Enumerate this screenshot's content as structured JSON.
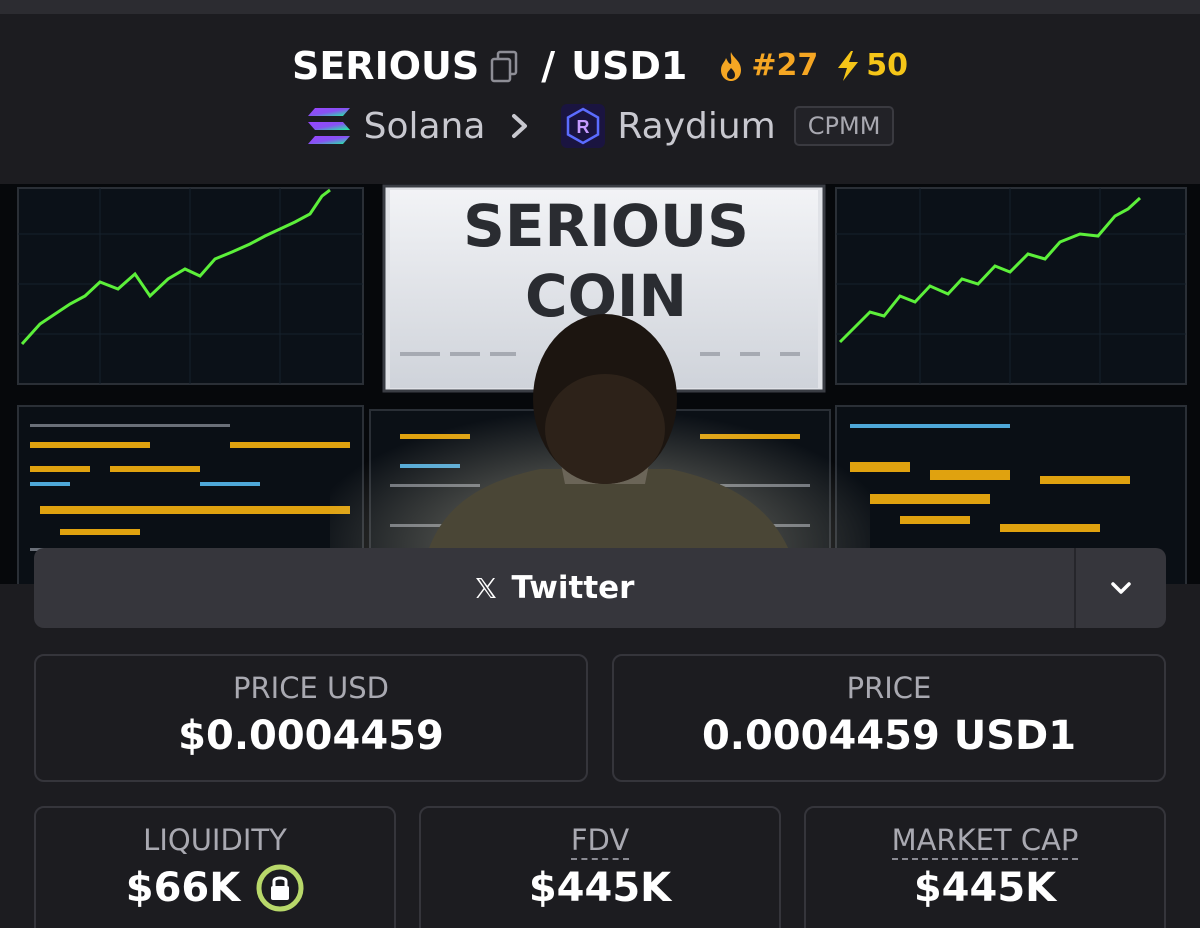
{
  "header": {
    "base_token": "SERIOUS",
    "separator": "/",
    "quote_token": "USD1",
    "trend_rank": "#27",
    "boost_count": "50",
    "chain": "Solana",
    "dex": "Raydium",
    "pool_type": "CPMM"
  },
  "banner": {
    "headline_line1": "SERIOUS",
    "headline_line2": "COIN"
  },
  "social": {
    "twitter_label": "Twitter"
  },
  "stats": {
    "price_usd_label": "PRICE USD",
    "price_usd_value": "$0.0004459",
    "price_label": "PRICE",
    "price_value": "0.0004459 USD1",
    "liquidity_label": "LIQUIDITY",
    "liquidity_value": "$66K",
    "fdv_label": "FDV",
    "fdv_value": "$445K",
    "market_cap_label": "MARKET CAP",
    "market_cap_value": "$445K"
  },
  "colors": {
    "background": "#1c1c20",
    "trend": "#f5a623",
    "boost": "#f5c518",
    "lock": "#b8d86a",
    "chart_line": "#5cf03a"
  },
  "icons": [
    "copy-icon",
    "fire-icon",
    "bolt-icon",
    "solana-icon",
    "chevron-right-icon",
    "raydium-icon",
    "x-logo-icon",
    "chevron-down-icon",
    "lock-icon"
  ]
}
